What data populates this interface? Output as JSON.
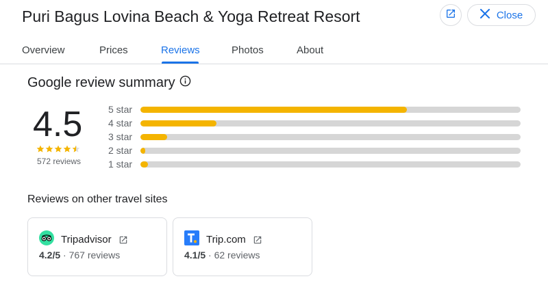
{
  "header": {
    "title": "Puri Bagus Lovina Beach & Yoga Retreat Resort",
    "close_label": "Close"
  },
  "tabs": [
    {
      "label": "Overview",
      "active": false
    },
    {
      "label": "Prices",
      "active": false
    },
    {
      "label": "Reviews",
      "active": true
    },
    {
      "label": "Photos",
      "active": false
    },
    {
      "label": "About",
      "active": false
    }
  ],
  "summary": {
    "title": "Google review summary",
    "rating": "4.5",
    "star_rating": 4.5,
    "review_count": "572 reviews",
    "distribution": [
      {
        "label": "5 star",
        "fraction": 0.7
      },
      {
        "label": "4 star",
        "fraction": 0.2
      },
      {
        "label": "3 star",
        "fraction": 0.07
      },
      {
        "label": "2 star",
        "fraction": 0.01
      },
      {
        "label": "1 star",
        "fraction": 0.02
      }
    ]
  },
  "other_sites": {
    "title": "Reviews on other travel sites",
    "sites": [
      {
        "name": "Tripadvisor",
        "score": "4.2/5",
        "reviews": "767 reviews",
        "icon": "tripadvisor-logo"
      },
      {
        "name": "Trip.com",
        "score": "4.1/5",
        "reviews": "62 reviews",
        "icon": "tripcom-logo"
      }
    ]
  },
  "colors": {
    "accent": "#1a73e8",
    "star": "#f4b400",
    "bar_track": "#d6d6d6",
    "tripadvisor": "#34e0a1",
    "tripcom": "#287dfa"
  }
}
